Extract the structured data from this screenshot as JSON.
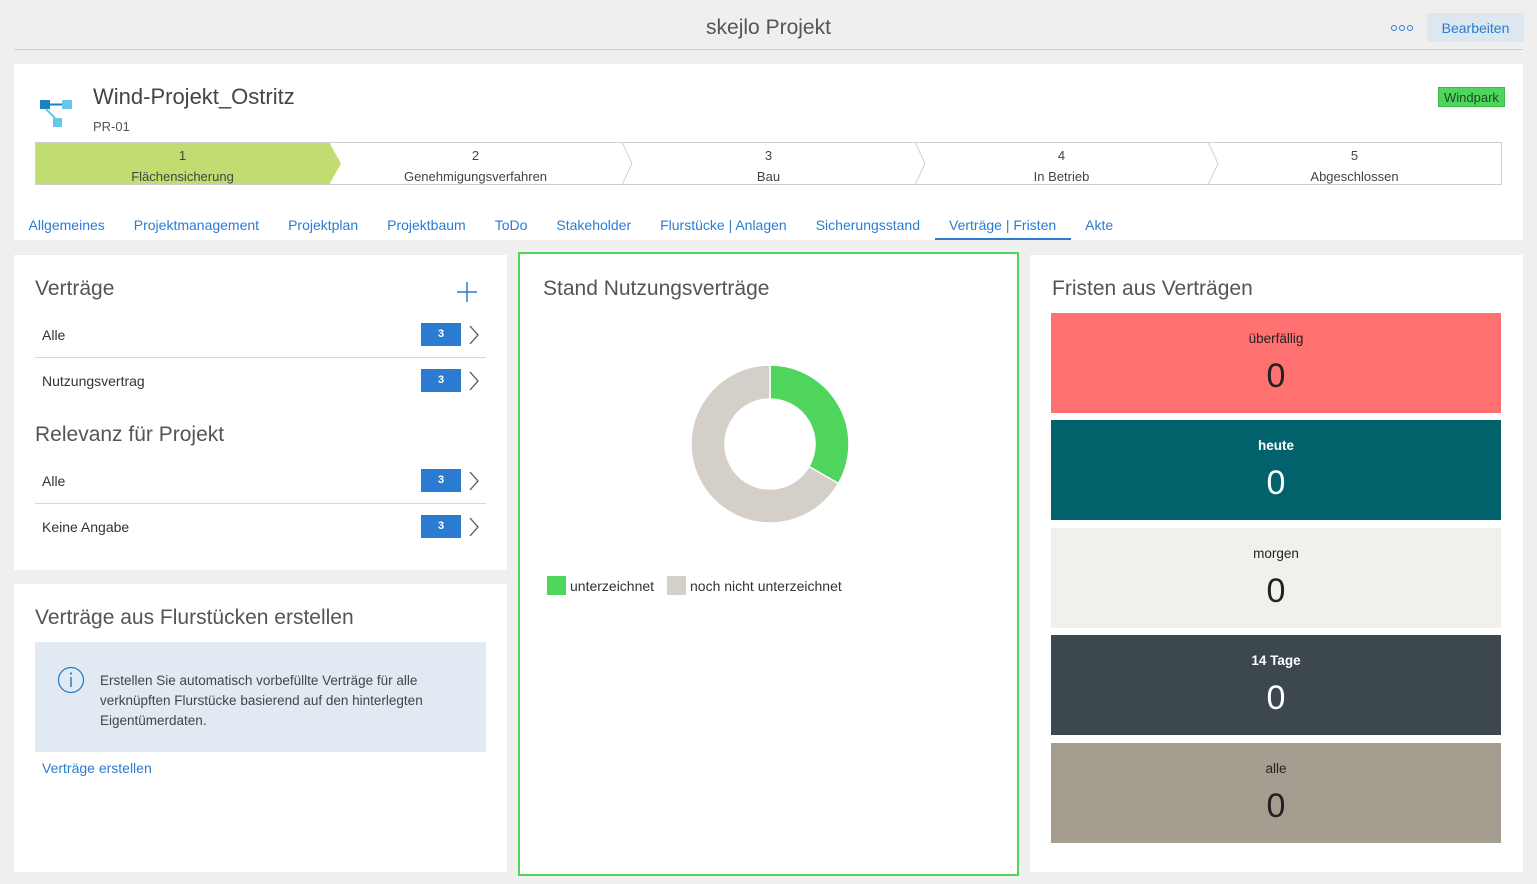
{
  "header": {
    "app_title": "skejlo Projekt",
    "edit_label": "Bearbeiten",
    "more_icon": "more-icon"
  },
  "project": {
    "name": "Wind-Projekt_Ostritz",
    "id": "PR-01",
    "tag": "Windpark",
    "tag_color": "#4fd45c",
    "stages": [
      {
        "num": "1",
        "label": "Flächensicherung",
        "active": true
      },
      {
        "num": "2",
        "label": "Genehmigungsverfahren",
        "active": false
      },
      {
        "num": "3",
        "label": "Bau",
        "active": false
      },
      {
        "num": "4",
        "label": "In Betrieb",
        "active": false
      },
      {
        "num": "5",
        "label": "Abgeschlossen",
        "active": false
      }
    ],
    "active_stage_color": "#c1dd71"
  },
  "tabs": [
    {
      "label": "Allgemeines",
      "active": false
    },
    {
      "label": "Projektmanagement",
      "active": false
    },
    {
      "label": "Projektplan",
      "active": false
    },
    {
      "label": "Projektbaum",
      "active": false
    },
    {
      "label": "ToDo",
      "active": false
    },
    {
      "label": "Stakeholder",
      "active": false
    },
    {
      "label": "Flurstücke | Anlagen",
      "active": false
    },
    {
      "label": "Sicherungsstand",
      "active": false
    },
    {
      "label": "Verträge | Fristen",
      "active": true
    },
    {
      "label": "Akte",
      "active": false
    }
  ],
  "contracts": {
    "title": "Verträge",
    "items": [
      {
        "label": "Alle",
        "count": "3"
      },
      {
        "label": "Nutzungsvertrag",
        "count": "3"
      }
    ],
    "relevance_title": "Relevanz für Projekt",
    "relevance_items": [
      {
        "label": "Alle",
        "count": "3"
      },
      {
        "label": "Keine Angabe",
        "count": "3"
      }
    ]
  },
  "create": {
    "title": "Verträge aus Flurstücken erstellen",
    "info": "Erstellen Sie automatisch vorbefüllte Verträge für alle verknüpften Flurstücke basierend auf den hinterlegten Eigentümerdaten.",
    "link": "Verträge erstellen"
  },
  "chart_panel": {
    "title": "Stand Nutzungsverträge"
  },
  "chart_data": {
    "type": "pie",
    "variant": "donut",
    "categories": [
      "unterzeichnet",
      "noch nicht unterzeichnet"
    ],
    "values": [
      1,
      2
    ],
    "colors": [
      "#4fd45c",
      "#d4d0c9"
    ],
    "legend_position": "bottom-left"
  },
  "deadlines": {
    "title": "Fristen aus Verträgen",
    "tiles": [
      {
        "label": "überfällig",
        "value": "0",
        "bg": "#ff7070",
        "fg": "#222222"
      },
      {
        "label": "heute",
        "value": "0",
        "bg": "#02626c",
        "fg": "#ffffff"
      },
      {
        "label": "morgen",
        "value": "0",
        "bg": "#f2f0eb",
        "fg": "#222222"
      },
      {
        "label": "14 Tage",
        "value": "0",
        "bg": "#3c474e",
        "fg": "#ffffff"
      },
      {
        "label": "alle",
        "value": "0",
        "bg": "#a59e90",
        "fg": "#222222"
      }
    ]
  }
}
